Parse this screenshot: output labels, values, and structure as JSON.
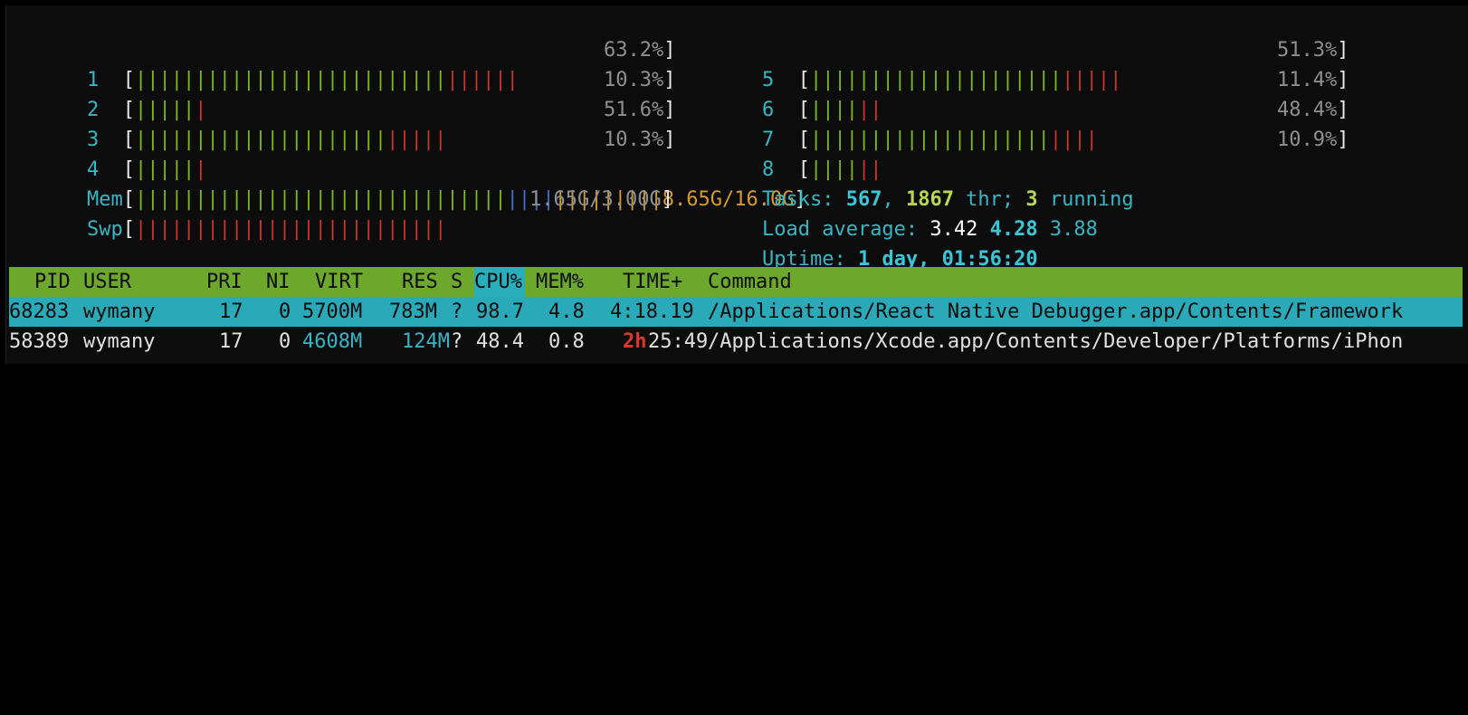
{
  "cpus": [
    {
      "num": "1",
      "pct": "63.2%",
      "green": 26,
      "red": 6
    },
    {
      "num": "2",
      "pct": "10.3%",
      "green": 5,
      "red": 1
    },
    {
      "num": "3",
      "pct": "51.6%",
      "green": 21,
      "red": 5
    },
    {
      "num": "4",
      "pct": "10.3%",
      "green": 5,
      "red": 1
    },
    {
      "num": "5",
      "pct": "51.3%",
      "green": 21,
      "red": 5
    },
    {
      "num": "6",
      "pct": "11.4%",
      "green": 4,
      "red": 2
    },
    {
      "num": "7",
      "pct": "48.4%",
      "green": 20,
      "red": 4
    },
    {
      "num": "8",
      "pct": "10.9%",
      "green": 4,
      "red": 2
    }
  ],
  "mem": {
    "label": "Mem",
    "value": "8.65G/16.0G"
  },
  "swp": {
    "label": "Swp",
    "value": "1.65G/3.00G"
  },
  "tasks": {
    "label": "Tasks: ",
    "count": "567",
    "sep1": ", ",
    "threads": "1867",
    "thr": " thr; ",
    "running": "3",
    "running_label": " running"
  },
  "load": {
    "label": "Load average: ",
    "one": "3.42",
    "five": "4.28",
    "fifteen": "3.88"
  },
  "uptime": {
    "label": "Uptime: ",
    "value": "1 day, 01:56:20"
  },
  "header": {
    "pid": "PID",
    "user": "USER",
    "pri": "PRI",
    "ni": "NI",
    "virt": "VIRT",
    "res": "RES",
    "s": "S",
    "cpu": "CPU%",
    "mem": "MEM%",
    "time": "TIME+",
    "command": "Command"
  },
  "processes": [
    {
      "pid": "68283",
      "user": "wymany",
      "pri": "17",
      "ni": "0",
      "virt": "5700M",
      "res": "783M",
      "s": "?",
      "cpu": "98.7",
      "mem": "4.8",
      "time_a": "",
      "time_b": "4:18.19",
      "command": "/Applications/React Native Debugger.app/Contents/Framework"
    },
    {
      "pid": "58389",
      "user": "wymany",
      "pri": "17",
      "ni": "0",
      "virt": "4608M",
      "res": "124M",
      "s": "?",
      "cpu": "48.4",
      "mem": "0.8",
      "time_a": "2h",
      "time_b": "25:49",
      "command": "/Applications/Xcode.app/Contents/Developer/Platforms/iPhon"
    }
  ]
}
